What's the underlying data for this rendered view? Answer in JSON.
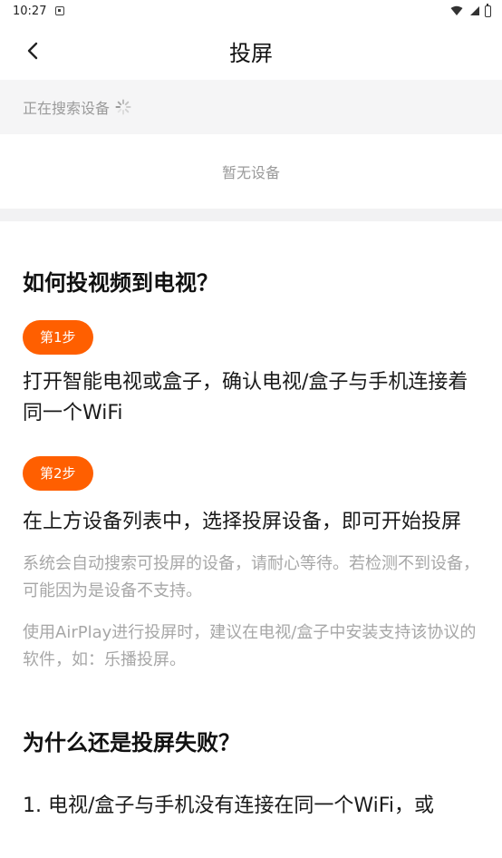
{
  "status_bar": {
    "time": "10:27"
  },
  "header": {
    "title": "投屏"
  },
  "search": {
    "status": "正在搜索设备"
  },
  "devices": {
    "empty_text": "暂无设备"
  },
  "guide": {
    "title": "如何投视频到电视？",
    "steps": [
      {
        "badge": "第1步",
        "text": "打开智能电视或盒子，确认电视/盒子与手机连接着同一个WiFi"
      },
      {
        "badge": "第2步",
        "text": "在上方设备列表中，选择投屏设备，即可开始投屏"
      }
    ],
    "notes": [
      "系统会自动搜索可投屏的设备，请耐心等待。若检测不到设备，可能因为是设备不支持。",
      "使用AirPlay进行投屏时，建议在电视/盒子中安装支持该协议的软件，如：乐播投屏。"
    ]
  },
  "faq": {
    "title": "为什么还是投屏失败？",
    "reasons": [
      "1. 电视/盒子与手机没有连接在同一个WiFi，或"
    ]
  },
  "colors": {
    "accent": "#ff5f00",
    "muted": "#9a9a9a",
    "section_bg": "#f5f5f6"
  }
}
